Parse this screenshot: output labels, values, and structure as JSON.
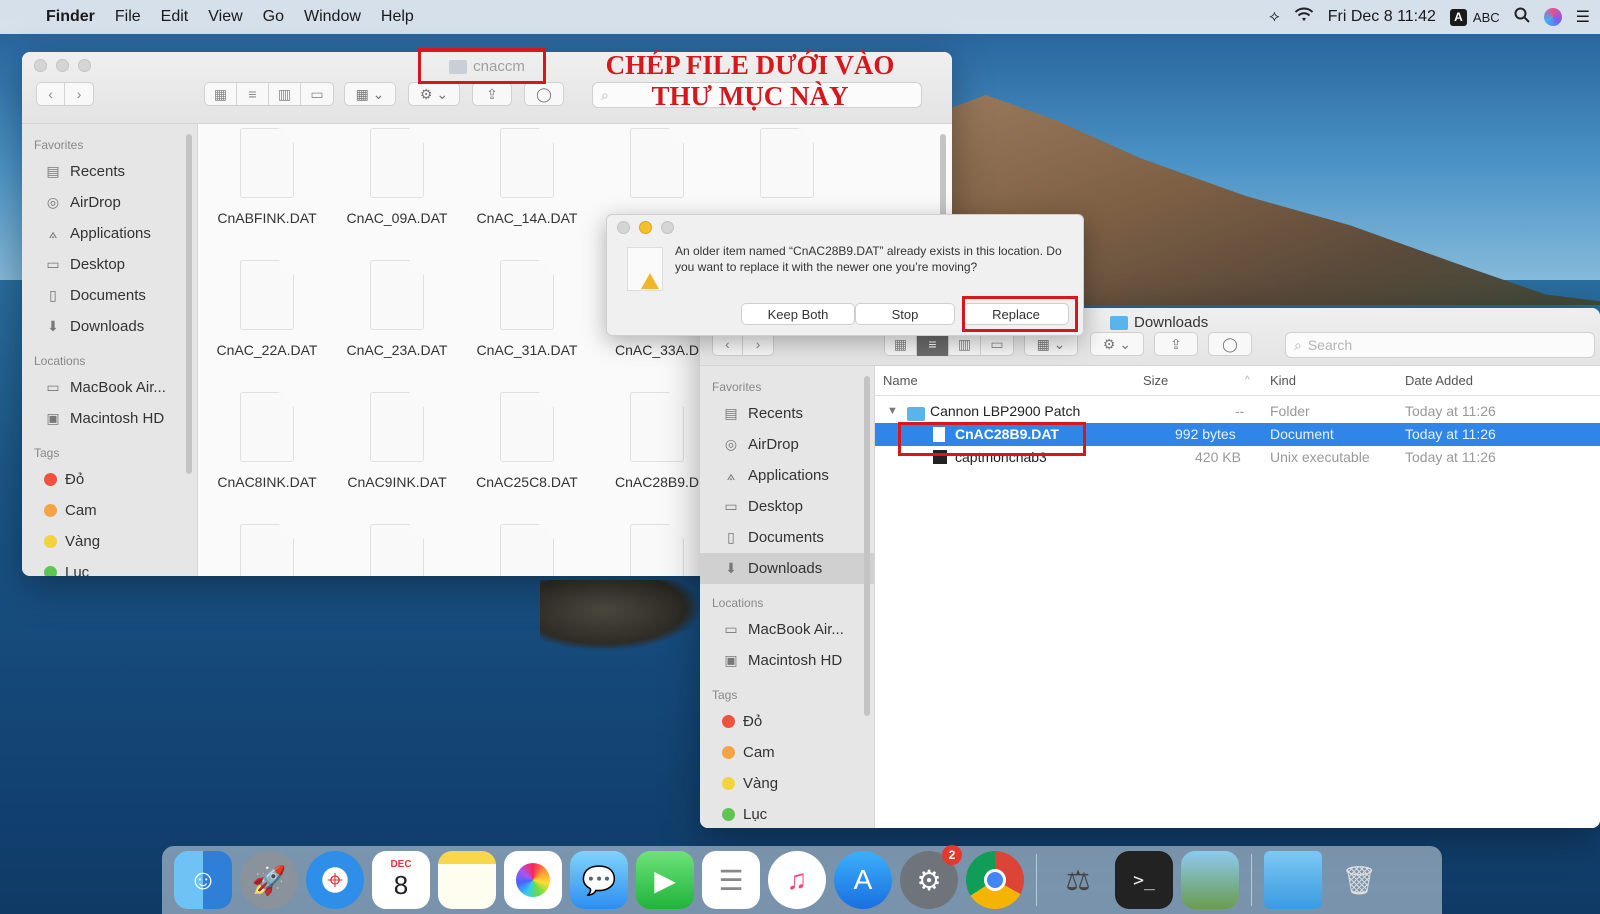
{
  "menubar": {
    "apple": "",
    "app": "Finder",
    "items": [
      "File",
      "Edit",
      "View",
      "Go",
      "Window",
      "Help"
    ],
    "clock": "Fri Dec 8  11:42",
    "input_badge": "A",
    "input_label": "ABC"
  },
  "annotation": {
    "line1": "CHÉP FILE DƯỚI VÀO",
    "line2": "THƯ MỤC NÀY"
  },
  "window_cnaccm": {
    "title": "cnaccm",
    "sidebar": {
      "favorites_header": "Favorites",
      "favorites": [
        "Recents",
        "AirDrop",
        "Applications",
        "Desktop",
        "Documents",
        "Downloads"
      ],
      "locations_header": "Locations",
      "locations": [
        "MacBook Air...",
        "Macintosh HD"
      ],
      "tags_header": "Tags",
      "tags": [
        {
          "name": "Đỏ",
          "color": "#f0513f"
        },
        {
          "name": "Cam",
          "color": "#f4a444"
        },
        {
          "name": "Vàng",
          "color": "#f2d33c"
        },
        {
          "name": "Lục",
          "color": "#5ec552"
        }
      ]
    },
    "files": [
      "CnABFINK.DAT",
      "CnAC_09A.DAT",
      "CnAC_14A.DAT",
      "",
      "",
      "CnAC_22A.DAT",
      "CnAC_23A.DAT",
      "CnAC_31A.DAT",
      "CnAC_33A.D",
      "CnAC8INK.DAT",
      "CnAC9INK.DAT",
      "CnAC25C8.DAT",
      "CnAC28B9.D"
    ]
  },
  "dialog": {
    "message": "An older item named “CnAC28B9.DAT” already exists in this location. Do you want to replace it with the newer one you’re moving?",
    "keep_both": "Keep Both",
    "stop": "Stop",
    "replace": "Replace"
  },
  "window_downloads": {
    "title": "Downloads",
    "search_placeholder": "Search",
    "sidebar": {
      "favorites_header": "Favorites",
      "favorites": [
        "Recents",
        "AirDrop",
        "Applications",
        "Desktop",
        "Documents",
        "Downloads"
      ],
      "locations_header": "Locations",
      "locations": [
        "MacBook Air...",
        "Macintosh HD"
      ],
      "tags_header": "Tags",
      "tags": [
        {
          "name": "Đỏ",
          "color": "#f0513f"
        },
        {
          "name": "Cam",
          "color": "#f4a444"
        },
        {
          "name": "Vàng",
          "color": "#f2d33c"
        },
        {
          "name": "Lục",
          "color": "#5ec552"
        }
      ]
    },
    "columns": {
      "name": "Name",
      "size": "Size",
      "kind": "Kind",
      "date": "Date Added"
    },
    "rows": [
      {
        "name": "Cannon LBP2900 Patch",
        "size": "--",
        "kind": "Folder",
        "date": "Today at 11:26"
      },
      {
        "name": "CnAC28B9.DAT",
        "size": "992 bytes",
        "kind": "Document",
        "date": "Today at 11:26"
      },
      {
        "name": "captmoncnab3",
        "size": "420 KB",
        "kind": "Unix executable",
        "date": "Today at 11:26"
      }
    ]
  },
  "dock": {
    "calendar_month": "DEC",
    "calendar_day": "8",
    "prefs_badge": "2"
  },
  "colors": {
    "selection": "#2f86e8",
    "annotation_red": "#d8171c"
  }
}
